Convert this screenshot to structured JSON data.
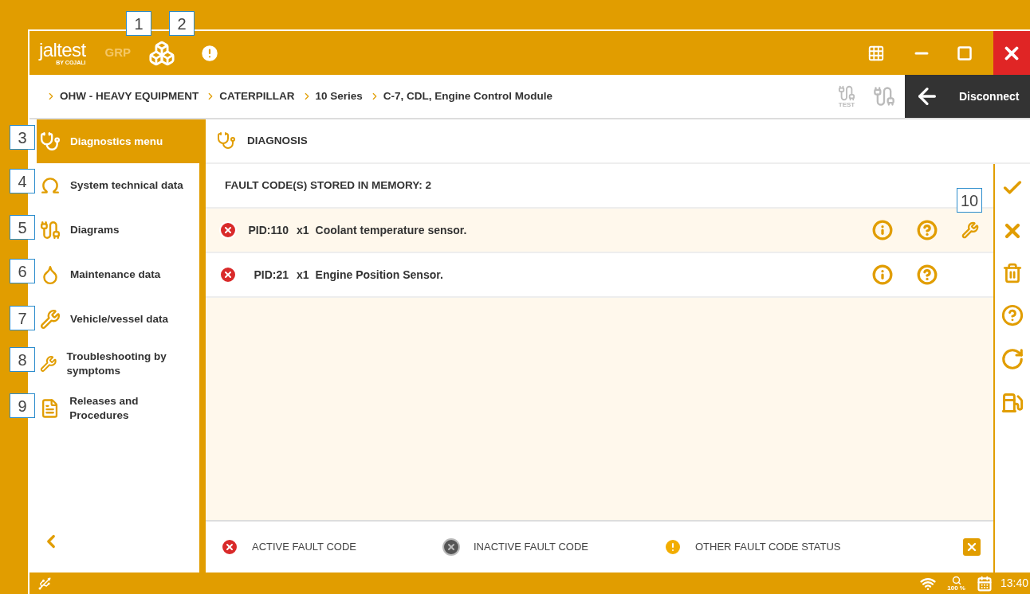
{
  "callouts": [
    {
      "label": "1"
    },
    {
      "label": "2"
    },
    {
      "label": "3"
    },
    {
      "label": "4"
    },
    {
      "label": "5"
    },
    {
      "label": "6"
    },
    {
      "label": "7"
    },
    {
      "label": "8"
    },
    {
      "label": "9"
    },
    {
      "label": "10"
    }
  ],
  "app_bar": {
    "logo": "jaltest",
    "logo_sub": "BY COJALI",
    "mode": "GRP"
  },
  "breadcrumb": [
    "OHW - HEAVY EQUIPMENT",
    "CATERPILLAR",
    "10 Series",
    "C-7, CDL, Engine Control Module"
  ],
  "connection": {
    "test_label": "TEST",
    "button": "Disconnect"
  },
  "sidebar": {
    "items": [
      {
        "kind": "diagnostics",
        "label": "Diagnostics menu",
        "selected": true
      },
      {
        "kind": "technical",
        "label": "System technical data",
        "selected": false
      },
      {
        "kind": "diagrams",
        "label": "Diagrams",
        "selected": false
      },
      {
        "kind": "maintenance",
        "label": "Maintenance data",
        "selected": false
      },
      {
        "kind": "vehicle",
        "label": "Vehicle/vessel data",
        "selected": false
      },
      {
        "kind": "troubleshooting",
        "label": "Troubleshooting by symptoms",
        "selected": false
      },
      {
        "kind": "releases",
        "label": "Releases and Procedures",
        "selected": false
      }
    ]
  },
  "panel": {
    "title": "DIAGNOSIS",
    "summary": "FAULT CODE(S) STORED IN MEMORY: 2",
    "faults": [
      {
        "kind": "active",
        "code": "PID:110",
        "count": "x1",
        "description": "Coolant temperature sensor.",
        "selected": true,
        "troubleshooting": true
      },
      {
        "kind": "active",
        "code": "PID:21",
        "count": "x1",
        "description": "Engine Position Sensor.",
        "selected": false,
        "troubleshooting": false
      }
    ],
    "legend": [
      {
        "kind": "active",
        "label": "ACTIVE FAULT CODE"
      },
      {
        "kind": "inactive",
        "label": "INACTIVE FAULT CODE"
      },
      {
        "kind": "other",
        "label": "OTHER FAULT CODE STATUS"
      }
    ]
  },
  "status_bar": {
    "zoom": "100 %",
    "time": "13:40"
  }
}
